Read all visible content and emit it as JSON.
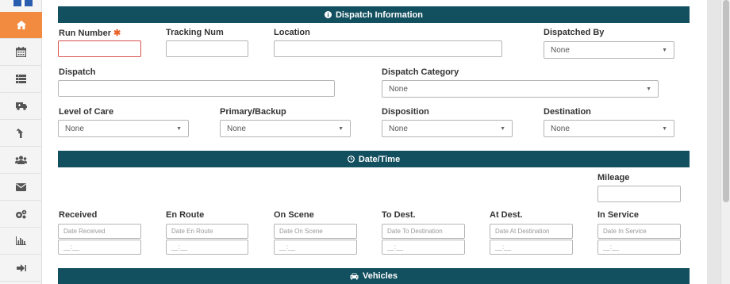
{
  "nav": {
    "items": [
      {
        "icon": "home-icon",
        "active": true
      },
      {
        "icon": "calendar-icon"
      },
      {
        "icon": "list-icon"
      },
      {
        "icon": "ambulance-icon"
      },
      {
        "icon": "thumbs-up-icon"
      },
      {
        "icon": "users-icon"
      },
      {
        "icon": "envelope-icon"
      },
      {
        "icon": "cogs-icon"
      },
      {
        "icon": "bar-chart-icon"
      },
      {
        "icon": "sign-out-icon"
      }
    ],
    "accent": "#f28a3f"
  },
  "colors": {
    "header_bg": "#13505f",
    "required": "#e8622a",
    "invalid_border": "#d9534f"
  },
  "dispatch": {
    "title": "Dispatch Information",
    "title_icon": "info-circle-icon",
    "run_number": {
      "label": "Run Number",
      "required_mark": "✱",
      "value": ""
    },
    "tracking_num": {
      "label": "Tracking Num",
      "value": ""
    },
    "location": {
      "label": "Location",
      "value": ""
    },
    "dispatched_by": {
      "label": "Dispatched By",
      "selected": "None"
    },
    "dispatch": {
      "label": "Dispatch",
      "value": ""
    },
    "dispatch_category": {
      "label": "Dispatch Category",
      "selected": "None"
    },
    "level_of_care": {
      "label": "Level of Care",
      "selected": "None"
    },
    "primary_backup": {
      "label": "Primary/Backup",
      "selected": "None"
    },
    "disposition": {
      "label": "Disposition",
      "selected": "None"
    },
    "destination": {
      "label": "Destination",
      "selected": "None"
    }
  },
  "datetime": {
    "title": "Date/Time",
    "title_icon": "clock-icon",
    "mileage": {
      "label": "Mileage",
      "value": ""
    },
    "time_placeholder": "__:__",
    "fields": [
      {
        "label": "Received",
        "placeholder": "Date Received"
      },
      {
        "label": "En Route",
        "placeholder": "Date En Route"
      },
      {
        "label": "On Scene",
        "placeholder": "Date On Scene"
      },
      {
        "label": "To Dest.",
        "placeholder": "Date To Destination"
      },
      {
        "label": "At Dest.",
        "placeholder": "Date At Destination"
      },
      {
        "label": "In Service",
        "placeholder": "Date In Service"
      }
    ]
  },
  "vehicles": {
    "title": "Vehicles",
    "title_icon": "car-icon"
  }
}
